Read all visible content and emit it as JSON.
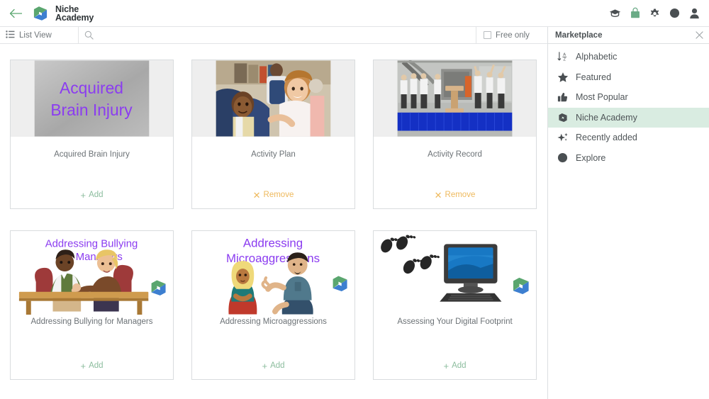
{
  "header": {
    "back_icon": "arrow-left-icon",
    "brand_line1": "Niche",
    "brand_line2": "Academy",
    "icons": [
      {
        "name": "graduation-cap-icon",
        "color": "#4a4f52"
      },
      {
        "name": "shopping-bag-icon",
        "color": "#6aab86"
      },
      {
        "name": "gear-icon",
        "color": "#4a4f52"
      },
      {
        "name": "circle-avatar-icon",
        "color": "#4a4f52"
      },
      {
        "name": "user-icon",
        "color": "#4a4f52"
      }
    ]
  },
  "toolbar": {
    "list_view_label": "List View",
    "list_view_icon": "list-icon",
    "search_icon": "search-icon",
    "search_value": "",
    "search_placeholder": "",
    "free_only_label": "Free only",
    "free_only_checked": false
  },
  "cards": [
    {
      "title": "Acquired Brain Injury",
      "action_label": "Add",
      "action_type": "add",
      "action_icon": "plus-icon",
      "thumb_type": "text-banner",
      "thumb_text_line1": "Acquired",
      "thumb_text_line2": "Brain Injury",
      "thumb_text_color": "#8b3cf0",
      "thumb_bg": "#b3b3b3"
    },
    {
      "title": "Activity Plan",
      "action_label": "Remove",
      "action_type": "remove",
      "action_icon": "close-icon",
      "thumb_type": "photo-classroom",
      "thumb_bg": "#eeeeee"
    },
    {
      "title": "Activity Record",
      "action_label": "Remove",
      "action_type": "remove",
      "action_icon": "close-icon",
      "thumb_type": "photo-stage",
      "thumb_bg": "#eeeeee"
    },
    {
      "title": "Addressing Bullying for Managers",
      "action_label": "Add",
      "action_type": "add",
      "action_icon": "plus-icon",
      "thumb_type": "illus-bullying",
      "thumb_text_line1": "Addressing Bullying",
      "thumb_text_line2": "for Managers",
      "thumb_text_color": "#8b3cf0",
      "thumb_bg": "#ffffff"
    },
    {
      "title": "Addressing Microaggressions",
      "action_label": "Add",
      "action_type": "add",
      "action_icon": "plus-icon",
      "thumb_type": "illus-micro",
      "thumb_text_line1": "Addressing",
      "thumb_text_line2": "Microaggressions",
      "thumb_text_color": "#8b3cf0",
      "thumb_bg": "#ffffff"
    },
    {
      "title": "Assessing Your Digital Footprint",
      "action_label": "Add",
      "action_type": "add",
      "action_icon": "plus-icon",
      "thumb_type": "illus-footprint",
      "thumb_bg": "#ffffff"
    }
  ],
  "sidebar": {
    "title": "Marketplace",
    "close_icon": "close-icon",
    "items": [
      {
        "label": "Alphabetic",
        "icon": "sort-alpha-icon",
        "active": false
      },
      {
        "label": "Featured",
        "icon": "star-icon",
        "active": false
      },
      {
        "label": "Most Popular",
        "icon": "thumbs-up-icon",
        "active": false
      },
      {
        "label": "Niche Academy",
        "icon": "niche-logo-icon",
        "active": true
      },
      {
        "label": "Recently added",
        "icon": "sparkle-icon",
        "active": false
      },
      {
        "label": "Explore",
        "icon": "circle-icon",
        "active": false
      }
    ]
  },
  "colors": {
    "brand_green": "#5aa66f",
    "brand_blue": "#3d7fd0",
    "accent_add": "#8cbd9e",
    "accent_remove": "#eeb95d",
    "active_row": "#d9ece1"
  }
}
